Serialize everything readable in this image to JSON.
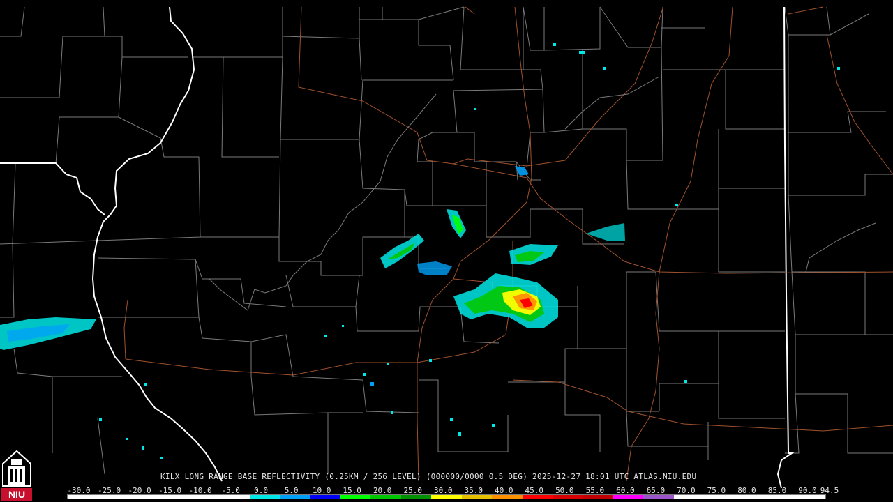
{
  "caption": "KILX LONG RANGE BASE REFLECTIVITY (0.25KM / 256 LEVEL) (000000/0000 0.5 DEG) 2025-12-27 18:01 UTC  ATLAS.NIU.EDU",
  "logo_text": "NIU",
  "legend": {
    "labels": [
      "-30.0",
      "-25.0",
      "-20.0",
      "-15.0",
      "-10.0",
      "-5.0",
      "0.0",
      "5.0",
      "10.0",
      "15.0",
      "20.0",
      "25.0",
      "30.0",
      "35.0",
      "40.0",
      "45.0",
      "50.0",
      "55.0",
      "60.0",
      "65.0",
      "70.0",
      "75.0",
      "80.0",
      "85.0",
      "90.0",
      "94.5"
    ],
    "colors": [
      "#000000",
      "#000000",
      "#000000",
      "#000000",
      "#000000",
      "#000000",
      "#00e8e8",
      "#00a0f6",
      "#0000f6",
      "#00ff00",
      "#00c800",
      "#009000",
      "#ffff00",
      "#e7c000",
      "#ff9000",
      "#ff0000",
      "#d60000",
      "#c00000",
      "#ff00ff",
      "#9955c9",
      "#ffffff",
      "#ffffff",
      "#ffffff",
      "#ffffff",
      "#ffffff"
    ]
  },
  "colors": {
    "background": "#000000",
    "county_border": "#7a7a7a",
    "state_border": "#ffffff",
    "highway": "#a0522d"
  }
}
